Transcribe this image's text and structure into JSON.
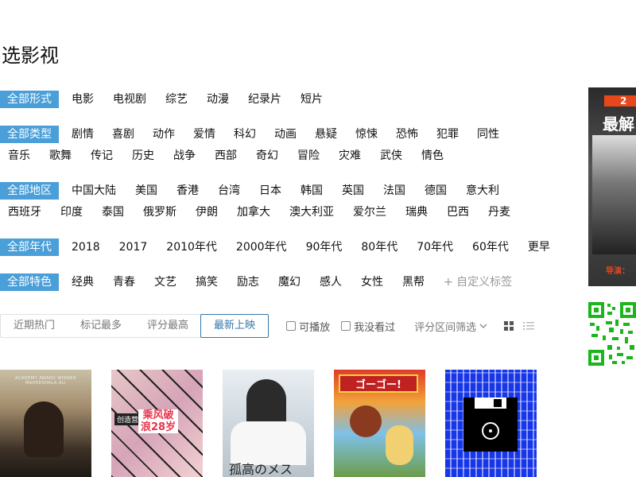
{
  "page": {
    "title": "选影视"
  },
  "filters": {
    "form": {
      "active": "全部形式",
      "items": [
        "电影",
        "电视剧",
        "综艺",
        "动漫",
        "纪录片",
        "短片"
      ]
    },
    "genre": {
      "active": "全部类型",
      "row1": [
        "剧情",
        "喜剧",
        "动作",
        "爱情",
        "科幻",
        "动画",
        "悬疑",
        "惊悚",
        "恐怖",
        "犯罪",
        "同性"
      ],
      "row2": [
        "音乐",
        "歌舞",
        "传记",
        "历史",
        "战争",
        "西部",
        "奇幻",
        "冒险",
        "灾难",
        "武侠",
        "情色"
      ]
    },
    "region": {
      "active": "全部地区",
      "row1": [
        "中国大陆",
        "美国",
        "香港",
        "台湾",
        "日本",
        "韩国",
        "英国",
        "法国",
        "德国",
        "意大利"
      ],
      "row2": [
        "西班牙",
        "印度",
        "泰国",
        "俄罗斯",
        "伊朗",
        "加拿大",
        "澳大利亚",
        "爱尔兰",
        "瑞典",
        "巴西",
        "丹麦"
      ]
    },
    "year": {
      "active": "全部年代",
      "items": [
        "2018",
        "2017",
        "2010年代",
        "2000年代",
        "90年代",
        "80年代",
        "70年代",
        "60年代",
        "更早"
      ]
    },
    "feature": {
      "active": "全部特色",
      "items": [
        "经典",
        "青春",
        "文艺",
        "搞笑",
        "励志",
        "魔幻",
        "感人",
        "女性",
        "黑帮"
      ],
      "custom": "+ 自定义标签"
    }
  },
  "sort": {
    "tabs": [
      "近期热门",
      "标记最多",
      "评分最高",
      "最新上映"
    ],
    "selected": "最新上映",
    "playable": "可播放",
    "not_seen": "我没看过",
    "range": "评分区间筛选"
  },
  "posters": [
    {
      "icon": "poster-true-detective",
      "text": "ACADEMY AWARD WINNER MAHERSHALA ALI"
    },
    {
      "icon": "poster-variety-show",
      "text": "创造营",
      "big": "乘风破浪28岁"
    },
    {
      "icon": "poster-medical-drama",
      "text": "孤高のメス"
    },
    {
      "icon": "poster-anime-race",
      "text": "ゴーゴー!"
    },
    {
      "icon": "poster-placeholder",
      "text": ""
    }
  ],
  "ad": {
    "line1": "2",
    "line2": "最解",
    "line3": "导演：",
    "color": "#e8471c"
  },
  "colors": {
    "active_tag": "#4a9fd8",
    "selected_sort": "#3377aa"
  }
}
